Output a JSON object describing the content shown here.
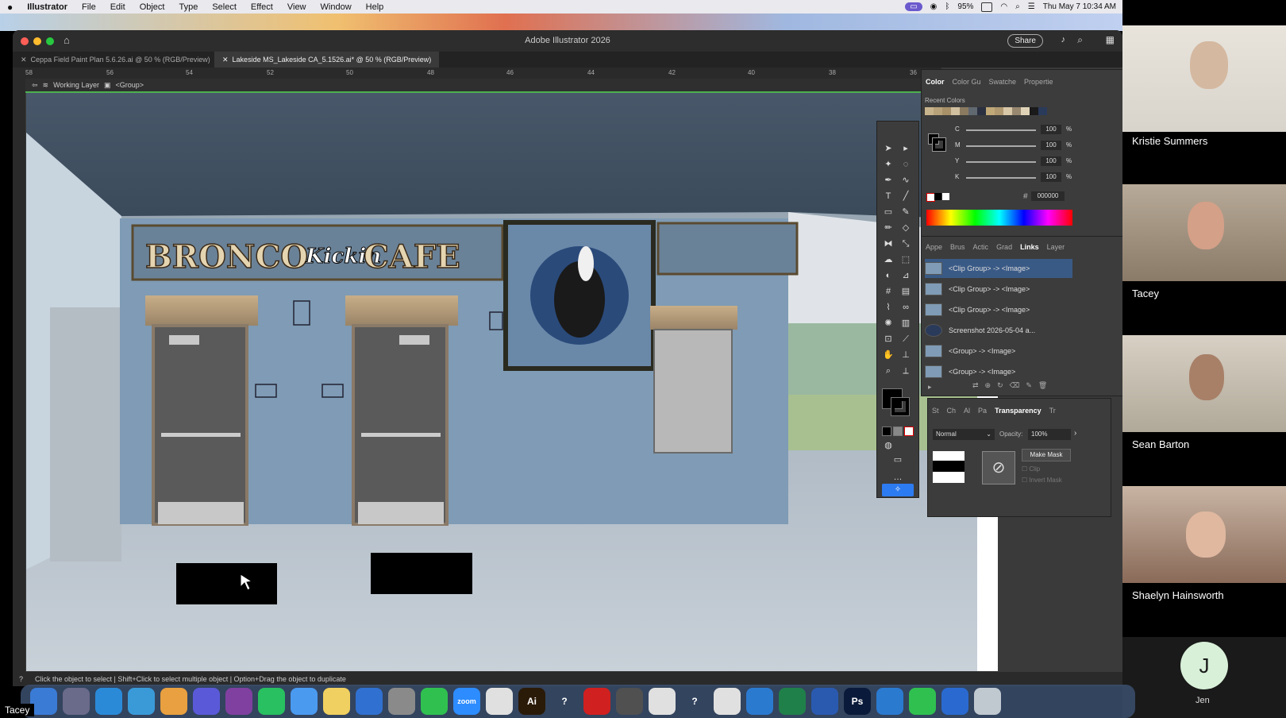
{
  "menubar": {
    "apple": "",
    "app": "Illustrator",
    "items": [
      "File",
      "Edit",
      "Object",
      "Type",
      "Select",
      "Effect",
      "View",
      "Window",
      "Help"
    ],
    "battery": "95%",
    "datetime": "Thu May 7  10:34 AM"
  },
  "window": {
    "title": "Adobe Illustrator 2026",
    "share_label": "Share",
    "tabs": [
      {
        "label": "Ceppa Field Paint Plan 5.6.26.ai @ 50 % (RGB/Preview)",
        "active": false
      },
      {
        "label": "Lakeside MS_Lakeside CA_5.1526.ai* @ 50 % (RGB/Preview)",
        "active": true
      }
    ],
    "ruler_ticks": [
      "58",
      "56",
      "54",
      "52",
      "50",
      "48",
      "46",
      "44",
      "42",
      "40",
      "38",
      "36"
    ],
    "breadcrumb": {
      "layer": "Working Layer",
      "group": "<Group>"
    },
    "status_text": "Click the object to select  |  Shift+Click to select multiple object  |  Option+Drag the object to duplicate"
  },
  "artwork": {
    "sign_left": "BRONCO",
    "sign_script": "Kickin",
    "sign_right": "CAFE"
  },
  "color_panel": {
    "tabs": [
      "Color",
      "Color Gu",
      "Swatche",
      "Propertie"
    ],
    "recent_label": "Recent Colors",
    "channels": [
      {
        "label": "C",
        "value": "100",
        "unit": "%"
      },
      {
        "label": "M",
        "value": "100",
        "unit": "%"
      },
      {
        "label": "Y",
        "value": "100",
        "unit": "%"
      },
      {
        "label": "K",
        "value": "100",
        "unit": "%"
      }
    ],
    "hex_symbol": "#",
    "hex": "000000",
    "swatches": [
      "#c8b48c",
      "#b8a27a",
      "#a89068",
      "#d0c0a0",
      "#8a7a60",
      "#606870",
      "#2a3040",
      "#c0a878",
      "#b09870",
      "#d8c8a8",
      "#988870",
      "#e0d4b8",
      "#1a1a1a",
      "#2a3a5a"
    ]
  },
  "links_panel": {
    "tabs": [
      "Appe",
      "Brus",
      "Actic",
      "Grad",
      "Links",
      "Layer"
    ],
    "rows": [
      "<Clip Group> -> <Image>",
      "<Clip Group> -> <Image>",
      "<Clip Group> -> <Image>",
      "Screenshot 2026-05-04 a...",
      "<Group> -> <Image>",
      "<Group> -> <Image>"
    ]
  },
  "transparency_panel": {
    "tabs": [
      "St",
      "Ch",
      "Al",
      "Pa",
      "Transparency",
      "Tr"
    ],
    "blend_mode": "Normal",
    "opacity_label": "Opacity:",
    "opacity": "100%",
    "make_mask": "Make Mask",
    "clip": "Clip",
    "invert_mask": "Invert Mask"
  },
  "participants": [
    {
      "name": "Kristie Summers",
      "color": "#d8d4cc"
    },
    {
      "name": "Tacey",
      "color": "#a89a88"
    },
    {
      "name": "Sean Barton",
      "color": "#c8c0b4"
    },
    {
      "name": "Shaelyn Hainsworth",
      "color": "#b4a090"
    },
    {
      "name": "Jen",
      "initial": "J",
      "color": "#1a1a1a"
    }
  ],
  "self_label": "Tacey",
  "dock": [
    {
      "label": "",
      "color": "#3a7bd5"
    },
    {
      "label": "",
      "color": "#6a6a8a"
    },
    {
      "label": "",
      "color": "#2a8ad8"
    },
    {
      "label": "",
      "color": "#3a9ad8"
    },
    {
      "label": "",
      "color": "#e8a040"
    },
    {
      "label": "",
      "color": "#5a5ad8"
    },
    {
      "label": "",
      "color": "#8040a0"
    },
    {
      "label": "",
      "color": "#28c060"
    },
    {
      "label": "",
      "color": "#4a9af0"
    },
    {
      "label": "",
      "color": "#f0d060"
    },
    {
      "label": "",
      "color": "#3070d0"
    },
    {
      "label": "",
      "color": "#8a8a8a"
    },
    {
      "label": "",
      "color": "#30c050"
    },
    {
      "label": "zoom",
      "color": "#2d8cff"
    },
    {
      "label": "",
      "color": "#e0e0e0"
    },
    {
      "label": "Ai",
      "color": "#2a1a08"
    },
    {
      "label": "?",
      "color": "transparent"
    },
    {
      "label": "",
      "color": "#d02020"
    },
    {
      "label": "",
      "color": "#505050"
    },
    {
      "label": "",
      "color": "#e0e0e0"
    },
    {
      "label": "?",
      "color": "transparent"
    },
    {
      "label": "",
      "color": "#e0e0e0"
    },
    {
      "label": "",
      "color": "#2a7ad0"
    },
    {
      "label": "",
      "color": "#20804a"
    },
    {
      "label": "",
      "color": "#2a5ab0"
    },
    {
      "label": "Ps",
      "color": "#0a1a3a"
    },
    {
      "label": "",
      "color": "#2a7ad0"
    },
    {
      "label": "",
      "color": "#30c050"
    },
    {
      "label": "",
      "color": "#2a6ad0"
    },
    {
      "label": "",
      "color": "#c0c8d0"
    }
  ]
}
